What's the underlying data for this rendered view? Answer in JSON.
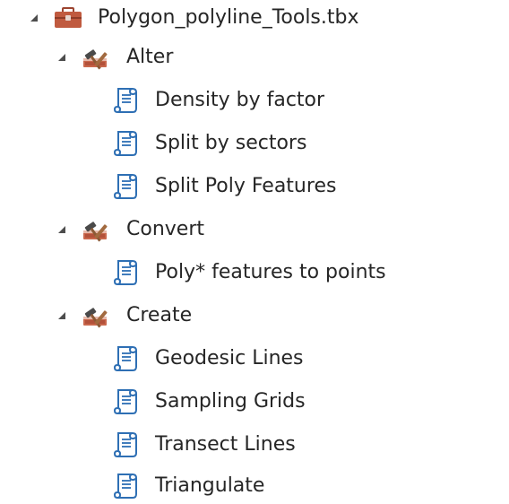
{
  "toolbox": {
    "name": "Polygon_polyline_Tools.tbx",
    "icon": "toolbox-icon",
    "expanded": true
  },
  "toolsets": [
    {
      "name": "Alter",
      "icon": "toolset-icon",
      "expanded": true,
      "tools": [
        {
          "name": "Density by factor",
          "icon": "script-tool-icon"
        },
        {
          "name": "Split by sectors",
          "icon": "script-tool-icon"
        },
        {
          "name": "Split Poly Features",
          "icon": "script-tool-icon"
        }
      ]
    },
    {
      "name": "Convert",
      "icon": "toolset-icon",
      "expanded": true,
      "tools": [
        {
          "name": "Poly* features to points",
          "icon": "script-tool-icon"
        }
      ]
    },
    {
      "name": "Create",
      "icon": "toolset-icon",
      "expanded": true,
      "tools": [
        {
          "name": "Geodesic Lines",
          "icon": "script-tool-icon"
        },
        {
          "name": "Sampling Grids",
          "icon": "script-tool-icon"
        },
        {
          "name": "Transect Lines",
          "icon": "script-tool-icon"
        },
        {
          "name": "Triangulate",
          "icon": "script-tool-icon"
        }
      ]
    }
  ],
  "colors": {
    "text": "#262626",
    "expander": "#4d4d4d",
    "toolbox_fill": "#b3533a",
    "script_blue": "#2e6fb4"
  }
}
